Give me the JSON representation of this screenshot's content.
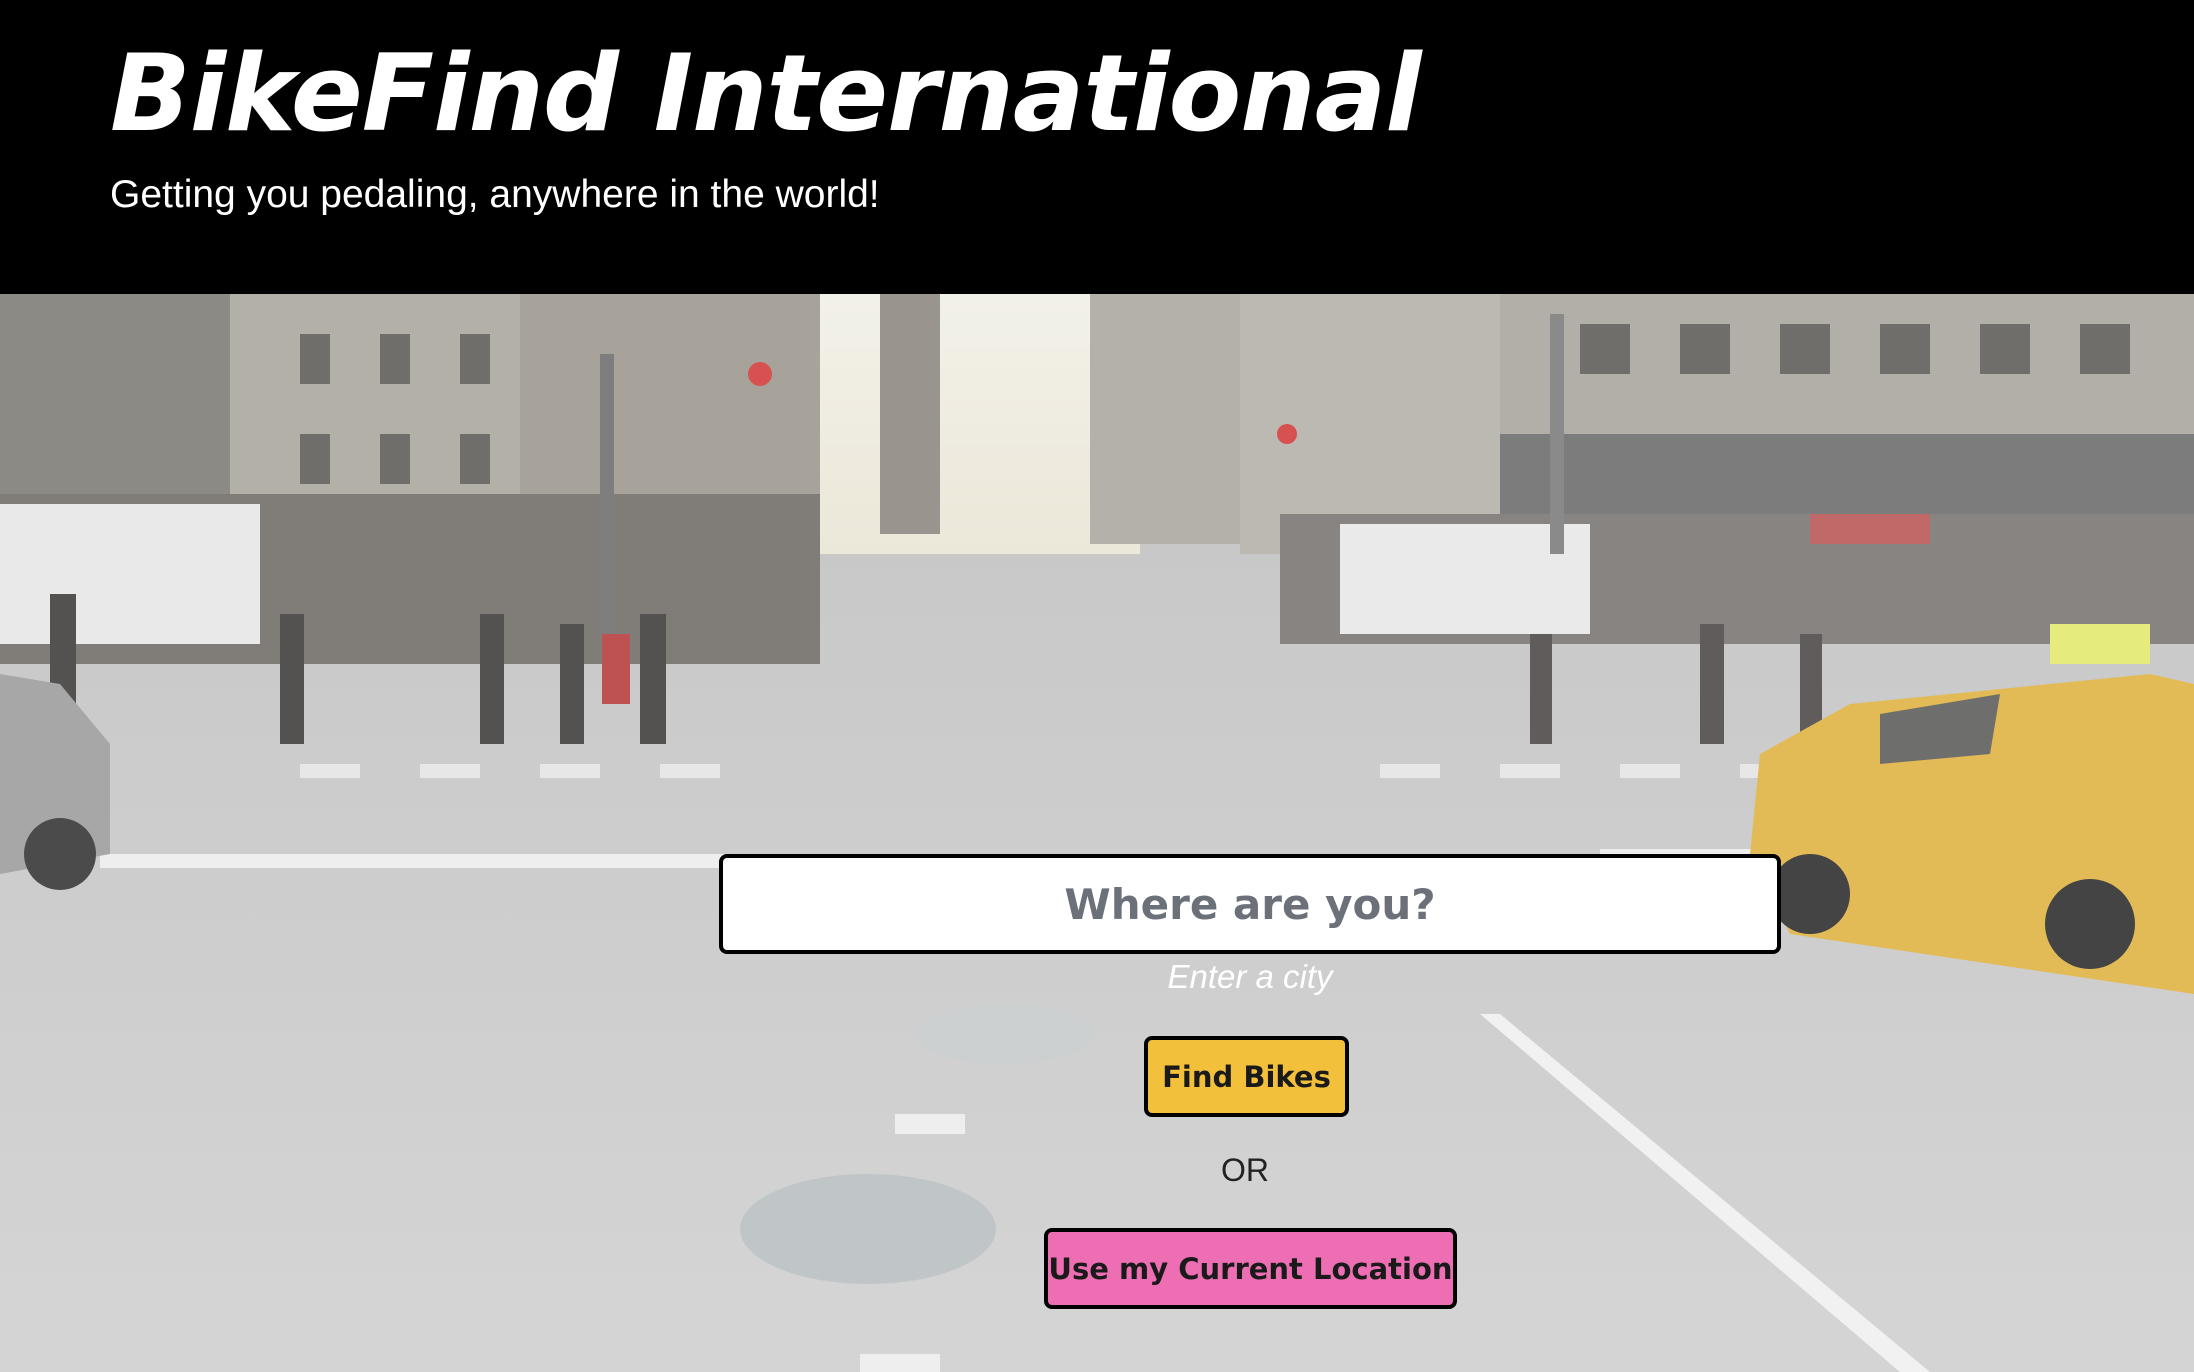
{
  "header": {
    "title": "BikeFind International",
    "tagline": "Getting you pedaling, anywhere in the world!"
  },
  "search": {
    "placeholder": "Where are you?",
    "hint": "Enter a city",
    "find_button_label": "Find Bikes",
    "or_label": "OR",
    "location_button_label": "Use my Current Location"
  },
  "colors": {
    "header_bg": "#000000",
    "find_button": "#f3c03b",
    "location_button": "#ee6eb3"
  },
  "hero": {
    "image_subject": "city street crosswalk with pedestrians and yellow taxi"
  }
}
